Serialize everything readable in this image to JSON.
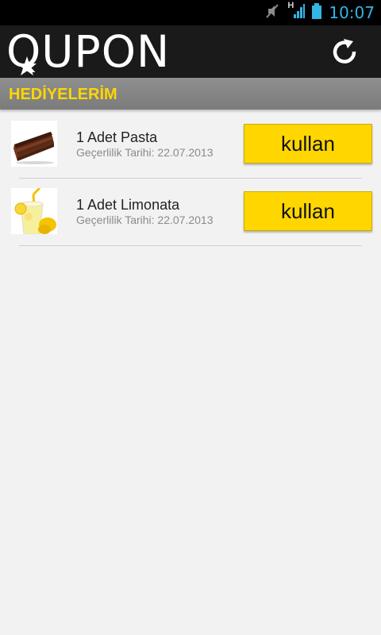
{
  "status_bar": {
    "network_label": "H",
    "time": "10:07",
    "icons": [
      "mute-icon",
      "signal-icon",
      "battery-icon"
    ]
  },
  "app": {
    "logo": "QUPON",
    "refresh_icon": "refresh-icon"
  },
  "section": {
    "title": "HEDİYELERİM"
  },
  "gifts": [
    {
      "title": "1 Adet Pasta",
      "validity": "Geçerlilik Tarihi: 22.07.2013",
      "button": "kullan",
      "image_icon": "cake-icon"
    },
    {
      "title": "1 Adet Limonata",
      "validity": "Geçerlilik Tarihi: 22.07.2013",
      "button": "kullan",
      "image_icon": "lemonade-icon"
    }
  ],
  "colors": {
    "accent": "#ffd600",
    "status_text": "#33b5e5",
    "actionbar": "#1a1a1a",
    "section_bg": "#7b7b7b"
  }
}
